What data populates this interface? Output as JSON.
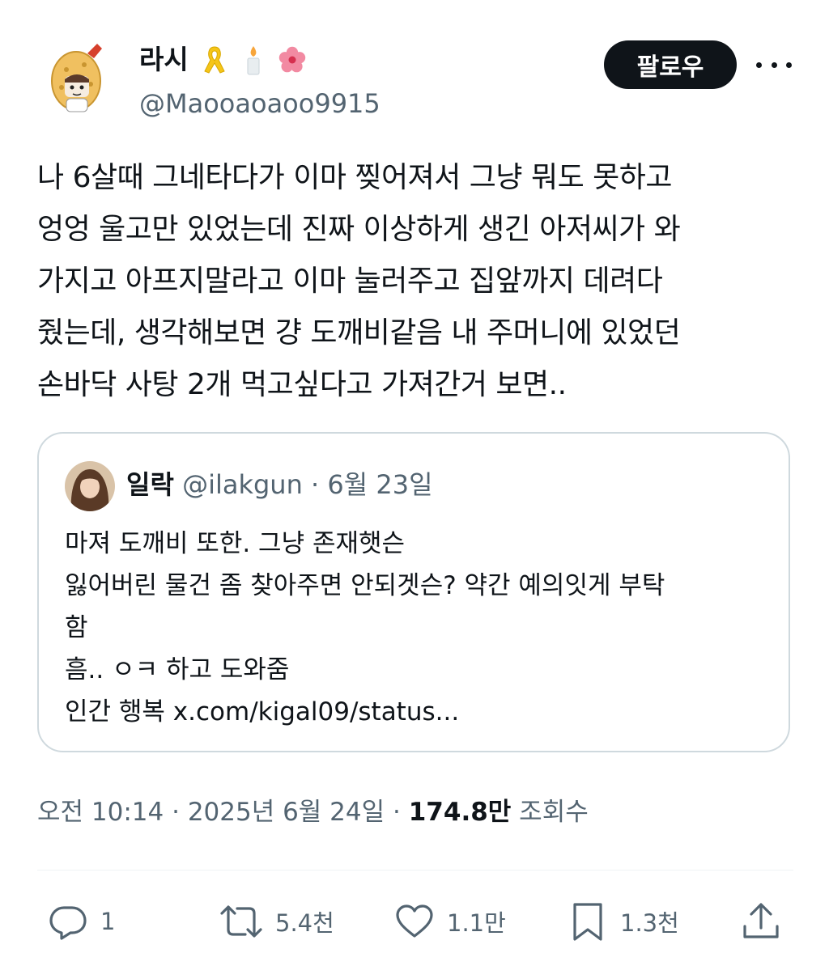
{
  "author": {
    "display_name": "라시",
    "handle": "@Maooaoaoo9915",
    "badges": [
      "yellow-ribbon-icon",
      "candle-icon",
      "hibiscus-icon"
    ]
  },
  "follow_button": {
    "label": "팔로우"
  },
  "tweet": {
    "lines": [
      "나 6살때 그네타다가 이마 찢어져서 그냥 뭐도 못하고",
      "엉엉 울고만 있었는데 진짜 이상하게 생긴 아저씨가 와",
      "가지고 아프지말라고 이마 눌러주고 집앞까지 데려다",
      "줬는데, 생각해보면 걍 도깨비같음 내 주머니에 있었던",
      "손바닥 사탕 2개 먹고싶다고 가져간거 보면.."
    ]
  },
  "quote": {
    "name": "일락",
    "handle": "@ilakgun",
    "date": "6월 23일",
    "lines": [
      "마져 도깨비 또한. 그냥 존재햇슨",
      "잃어버린 물건 좀 찾아주면 안되겟슨? 약간 예의잇게 부탁",
      "함",
      "흠.. ㅇㅋ 하고 도와줌",
      "인간 행복 x.com/kigal09/status..."
    ]
  },
  "meta": {
    "time": "오전 10:14",
    "date": "2025년 6월 24일",
    "views": "174.8만",
    "views_label": "조회수"
  },
  "actions": {
    "reply": "1",
    "retweet": "5.4천",
    "like": "1.1만",
    "bookmark": "1.3천"
  },
  "colors": {
    "text": "#0f1419",
    "secondary": "#536471",
    "border": "#cfd9de",
    "ribbon": "#f5c518"
  }
}
